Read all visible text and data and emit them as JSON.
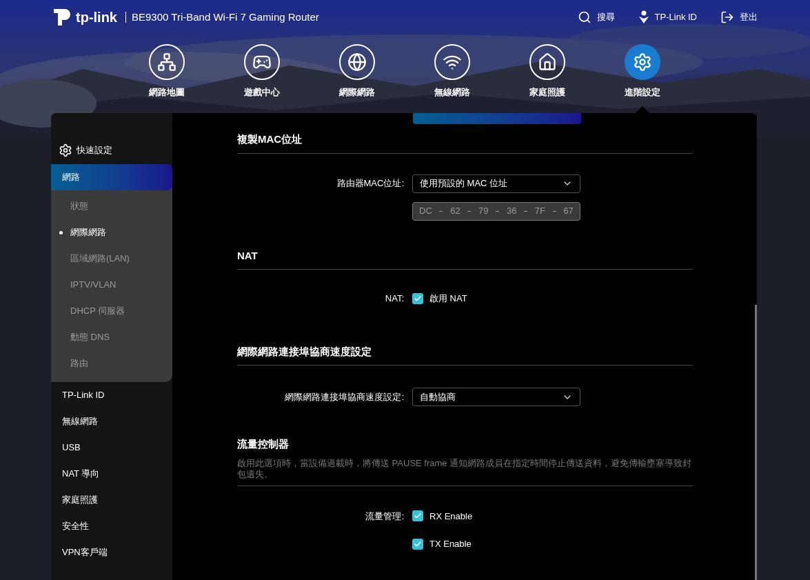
{
  "header": {
    "brand": "tp-link",
    "product": "BE9300 Tri-Band Wi-Fi 7 Gaming Router",
    "actions": [
      {
        "kind": "search",
        "label": "搜尋"
      },
      {
        "kind": "id",
        "label": "TP-Link ID"
      },
      {
        "kind": "logout",
        "label": "登出"
      }
    ]
  },
  "nav": [
    {
      "kind": "map",
      "label": "網路地圖",
      "selected": false
    },
    {
      "kind": "game",
      "label": "遊戲中心",
      "selected": false
    },
    {
      "kind": "globe",
      "label": "網際網路",
      "selected": false
    },
    {
      "kind": "wifi",
      "label": "無線網路",
      "selected": false
    },
    {
      "kind": "home",
      "label": "家庭照護",
      "selected": false
    },
    {
      "kind": "gear",
      "label": "進階設定",
      "selected": true
    }
  ],
  "sidebar": {
    "quick_setup": "快速設定",
    "items": [
      {
        "label": "網路",
        "selected": true,
        "expanded": true,
        "children": [
          {
            "label": "狀態",
            "selected": false
          },
          {
            "label": "網際網路",
            "selected": true
          },
          {
            "label": "區域網路(LAN)",
            "selected": false
          },
          {
            "label": "IPTV/VLAN",
            "selected": false
          },
          {
            "label": "DHCP 伺服器",
            "selected": false
          },
          {
            "label": "動態 DNS",
            "selected": false
          },
          {
            "label": "路由",
            "selected": false
          }
        ]
      },
      {
        "label": "TP-Link ID",
        "selected": false
      },
      {
        "label": "無線網路",
        "selected": false
      },
      {
        "label": "USB",
        "selected": false
      },
      {
        "label": "NAT 導向",
        "selected": false
      },
      {
        "label": "家庭照護",
        "selected": false
      },
      {
        "label": "安全性",
        "selected": false
      },
      {
        "label": "VPN客戶端",
        "selected": false
      }
    ]
  },
  "sections": [
    {
      "title": "複製MAC位址",
      "rows": [
        {
          "kind": "select",
          "label": "路由器MAC位址:",
          "value": "使用預設的 MAC 位址"
        },
        {
          "kind": "mac",
          "octets": [
            "DC",
            "62",
            "79",
            "36",
            "7F",
            "67"
          ]
        }
      ]
    },
    {
      "title": "NAT",
      "rows": [
        {
          "kind": "checkbox",
          "label": "NAT:",
          "text": "啟用 NAT",
          "checked": true
        }
      ]
    },
    {
      "title": "網際網路連接埠協商速度設定",
      "rows": [
        {
          "kind": "select",
          "label": "網際網路連接埠協商速度設定:",
          "value": "自動協商"
        }
      ]
    },
    {
      "title": "流量控制器",
      "description": "啟用此選項時，當設備過載時，將傳送 PAUSE frame 通知網路成員在指定時間停止傳送資料，避免傳輸壅塞導致封包遺失。",
      "rows": [
        {
          "kind": "checkbox",
          "label": "流量管理:",
          "text": "RX Enable",
          "checked": true
        },
        {
          "kind": "checkbox",
          "text": "TX Enable",
          "checked": true
        }
      ]
    }
  ]
}
